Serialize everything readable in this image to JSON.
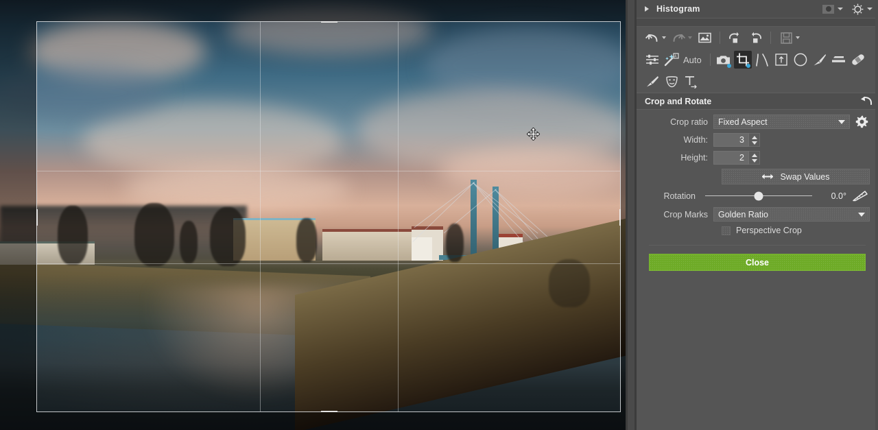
{
  "histogram": {
    "title": "Histogram",
    "expander_icon": "triangle-right-icon",
    "clipping_icon": "clipping-indicator-icon",
    "exposure_icon": "exposure-sun-icon"
  },
  "history_toolbar": {
    "buttons": [
      {
        "name": "undo-button",
        "icon": "undo-icon",
        "enabled": true,
        "has_dropdown": true
      },
      {
        "name": "redo-button",
        "icon": "redo-icon",
        "enabled": false,
        "has_dropdown": true
      },
      {
        "name": "show-original-button",
        "icon": "image-icon",
        "enabled": true,
        "has_dropdown": false
      },
      {
        "name": "rotate-left-button",
        "icon": "rotate-left-icon",
        "enabled": true,
        "has_dropdown": false
      },
      {
        "name": "rotate-right-button",
        "icon": "rotate-right-icon",
        "enabled": true,
        "has_dropdown": false
      },
      {
        "name": "save-button",
        "icon": "save-disk-icon",
        "enabled": false,
        "has_dropdown": true
      }
    ]
  },
  "tools": {
    "auto_label": "Auto",
    "row1": [
      {
        "name": "adjustments-tool",
        "icon": "sliders-icon",
        "selected": false,
        "badge": false
      },
      {
        "name": "auto-enhance-tool",
        "icon": "magic-wand-icon",
        "selected": false,
        "badge": false
      },
      {
        "name": "exposure-tool",
        "icon": "camera-icon",
        "selected": false,
        "badge": true
      },
      {
        "name": "crop-and-rotate-tool",
        "icon": "crop-icon",
        "selected": true,
        "badge": true
      },
      {
        "name": "curves-tool",
        "icon": "curves-icon",
        "selected": false,
        "badge": false
      },
      {
        "name": "perspective-tool",
        "icon": "perspective-icon",
        "selected": false,
        "badge": false
      },
      {
        "name": "vignette-tool",
        "icon": "ellipse-icon",
        "selected": false,
        "badge": false
      },
      {
        "name": "brush-tool",
        "icon": "paint-brush-icon",
        "selected": false,
        "badge": false
      },
      {
        "name": "gradient-tool",
        "icon": "gradient-filter-icon",
        "selected": false,
        "badge": false
      },
      {
        "name": "blemish-removal-tool",
        "icon": "bandage-icon",
        "selected": false,
        "badge": false
      }
    ],
    "row2": [
      {
        "name": "retouch-tool",
        "icon": "retouch-pen-icon",
        "selected": false,
        "badge": false
      },
      {
        "name": "portrait-tool",
        "icon": "face-mask-icon",
        "selected": false,
        "badge": false
      },
      {
        "name": "text-tool",
        "icon": "text-tool-icon",
        "selected": false,
        "badge": false
      }
    ]
  },
  "crop_panel": {
    "section_title": "Crop and Rotate",
    "reset_icon": "reset-arrow-icon",
    "crop_ratio": {
      "label": "Crop ratio",
      "value": "Fixed Aspect",
      "settings_icon": "gear-icon"
    },
    "width": {
      "label": "Width:",
      "value": "3"
    },
    "height": {
      "label": "Height:",
      "value": "2"
    },
    "swap": {
      "label": "Swap Values",
      "icon": "swap-arrows-icon"
    },
    "rotation": {
      "label": "Rotation",
      "value": "0.0°",
      "slider_percent": 50,
      "straighten_icon": "straighten-ruler-icon"
    },
    "crop_marks": {
      "label": "Crop Marks",
      "value": "Golden Ratio"
    },
    "perspective_crop": {
      "label": "Perspective Crop",
      "checked": false
    },
    "close_button": {
      "label": "Close",
      "color": "#6eab27"
    }
  },
  "canvas": {
    "cursor": "move-cursor",
    "crop_overlay": {
      "name": "crop-selection-rectangle",
      "guide_style": "Golden Ratio"
    }
  }
}
